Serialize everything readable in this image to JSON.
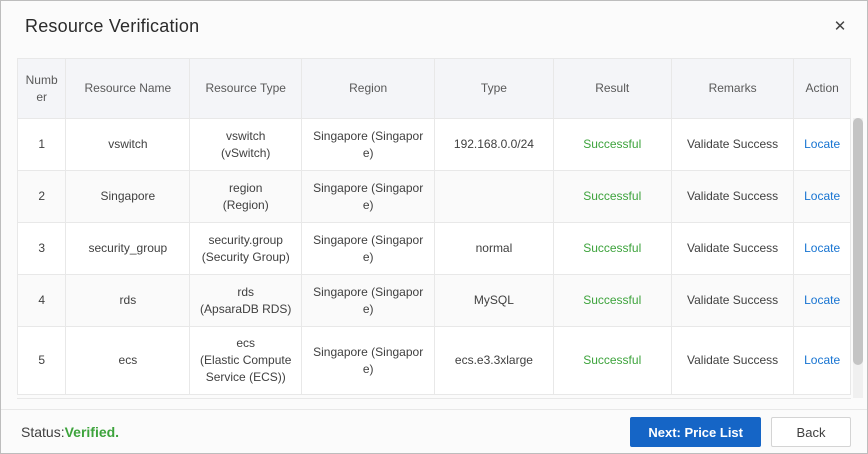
{
  "dialog": {
    "title": "Resource Verification",
    "close_glyph": "✕"
  },
  "table": {
    "columns": [
      {
        "key": "number",
        "label": "Number"
      },
      {
        "key": "resource-name",
        "label": "Resource Name"
      },
      {
        "key": "resource-type",
        "label": "Resource Type"
      },
      {
        "key": "region",
        "label": "Region"
      },
      {
        "key": "type",
        "label": "Type"
      },
      {
        "key": "result",
        "label": "Result"
      },
      {
        "key": "remarks",
        "label": "Remarks"
      },
      {
        "key": "action",
        "label": "Action"
      }
    ],
    "rows": [
      {
        "number": "1",
        "name": "vswitch",
        "resource_type": "vswitch\n(vSwitch)",
        "region": "Singapore (Singapore)",
        "type": "192.168.0.0/24",
        "result": "Successful",
        "remarks": "Validate Success",
        "action": "Locate"
      },
      {
        "number": "2",
        "name": "Singapore",
        "resource_type": "region\n(Region)",
        "region": "Singapore (Singapore)",
        "type": "",
        "result": "Successful",
        "remarks": "Validate Success",
        "action": "Locate"
      },
      {
        "number": "3",
        "name": "security_group",
        "resource_type": "security.group\n(Security Group)",
        "region": "Singapore (Singapore)",
        "type": "normal",
        "result": "Successful",
        "remarks": "Validate Success",
        "action": "Locate"
      },
      {
        "number": "4",
        "name": "rds",
        "resource_type": "rds\n(ApsaraDB RDS)",
        "region": "Singapore (Singapore)",
        "type": "MySQL",
        "result": "Successful",
        "remarks": "Validate Success",
        "action": "Locate"
      },
      {
        "number": "5",
        "name": "ecs",
        "resource_type": "ecs\n(Elastic Compute Service (ECS))",
        "region": "Singapore (Singapore)",
        "type": "ecs.e3.3xlarge",
        "result": "Successful",
        "remarks": "Validate Success",
        "action": "Locate"
      }
    ]
  },
  "footer": {
    "status_label": "Status:",
    "status_value": "Verified.",
    "next_button": "Next: Price List",
    "back_button": "Back"
  },
  "colors": {
    "primary_button": "#1565c6",
    "success_green": "#3da33c",
    "link_blue": "#1673d1",
    "header_bg": "#f4f5f8"
  }
}
